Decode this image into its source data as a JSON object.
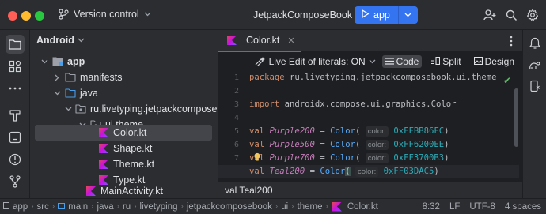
{
  "titlebar": {
    "vcs_label": "Version control",
    "project_title": "JetpackComposeBook",
    "run_config": "app",
    "icons": [
      "version-control-icon",
      "play-icon",
      "chevron-down-icon",
      "add-user-icon",
      "search-icon",
      "gear-icon"
    ]
  },
  "project_panel": {
    "header": "Android",
    "tree": [
      {
        "label": "app",
        "bold": true
      },
      {
        "label": "manifests"
      },
      {
        "label": "java"
      },
      {
        "label": "ru.livetyping.jetpackcomposebook"
      },
      {
        "label": "ui.theme"
      },
      {
        "label": "Color.kt",
        "selected": true
      },
      {
        "label": "Shape.kt"
      },
      {
        "label": "Theme.kt"
      },
      {
        "label": "Type.kt"
      },
      {
        "label": "MainActivity.kt"
      }
    ]
  },
  "editor": {
    "tab_label": "Color.kt",
    "toolbar": {
      "live_edit": "Live Edit of literals: ON",
      "code": "Code",
      "split": "Split",
      "design": "Design"
    },
    "line_numbers": [
      "1",
      "2",
      "3",
      "4",
      "5",
      "6",
      "7",
      "8"
    ],
    "current_line": "8",
    "code": {
      "l1_kw": "package",
      "l1_rest": " ru.livetyping.jetpackcomposebook.ui.theme",
      "l3_kw": "import",
      "l3_rest": " androidx.compose.ui.graphics.Color",
      "val_kw": "val",
      "color_fn": "Color",
      "hint": "color:",
      "colors": [
        {
          "name": "Purple200",
          "hex": "0xFFBB86FC"
        },
        {
          "name": "Purple500",
          "hex": "0xFF6200EE"
        },
        {
          "name": "Purple700",
          "hex": "0xFF3700B3"
        },
        {
          "name": "Teal200",
          "hex": "0xFF03DAC5"
        }
      ]
    },
    "status_text": "val Teal200"
  },
  "statusbar": {
    "breadcrumbs": [
      "app",
      "src",
      "main",
      "java",
      "ru",
      "livetyping",
      "jetpackcomposebook",
      "ui",
      "theme",
      "Color.kt"
    ],
    "position": "8:32",
    "line_sep": "LF",
    "encoding": "UTF-8",
    "indent": "4 spaces"
  },
  "colors": {
    "accent": "#3574f0",
    "background": "#2b2d30",
    "editor_bg": "#1e1f22",
    "keyword": "#cf8e6d",
    "property": "#c77dbb",
    "function": "#56a8f5",
    "number": "#2aacb8"
  }
}
